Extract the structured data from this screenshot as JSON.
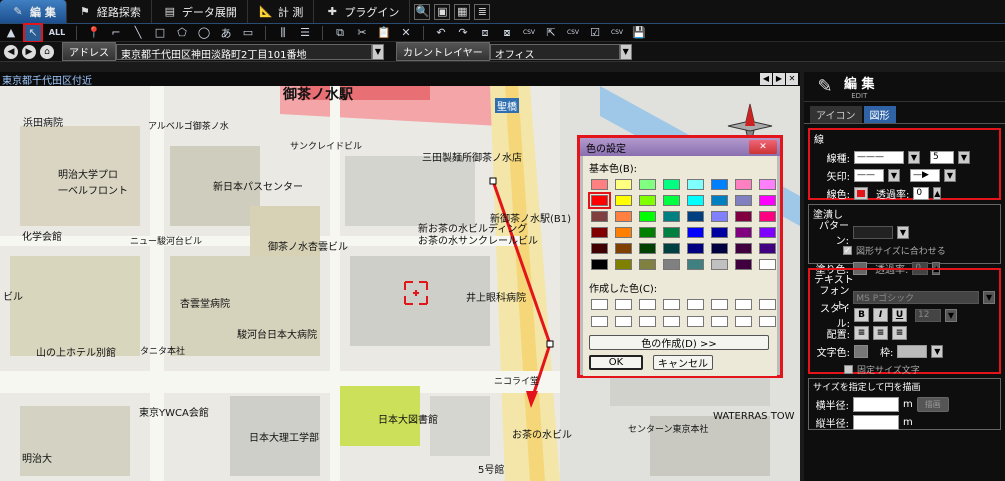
{
  "tabs": [
    {
      "label": "編 集",
      "icon": "edit-icon"
    },
    {
      "label": "経路探索",
      "icon": "route-icon"
    },
    {
      "label": "データ展開",
      "icon": "data-icon"
    },
    {
      "label": "計 測",
      "icon": "measure-icon"
    },
    {
      "label": "プラグイン",
      "icon": "plugin-icon"
    }
  ],
  "toolbar": {
    "all_label": "ALL",
    "csv1": "CSV",
    "csv2": "CSV",
    "csv3": "CSV"
  },
  "address": {
    "label": "アドレス",
    "value": "東京都千代田区神田淡路町2丁目101番地",
    "layer_label": "カレントレイヤー",
    "layer_value": "オフィス"
  },
  "breadcrumb": "東京都千代田区付近",
  "map": {
    "labels": [
      {
        "text": "御茶ノ水駅"
      },
      {
        "text": "聖橋"
      },
      {
        "text": "浜田病院"
      },
      {
        "text": "アルベルゴ御茶ノ水"
      },
      {
        "text": "サンクレイドビル"
      },
      {
        "text": "明治大学プロ"
      },
      {
        "text": "一ベルフロント"
      },
      {
        "text": "三田製麺所御茶ノ水店"
      },
      {
        "text": "新日本パスセンター"
      },
      {
        "text": "新御茶ノ水駅(B1)"
      },
      {
        "text": "新お茶の水ビルディング"
      },
      {
        "text": "お茶の水サンクレールビル"
      },
      {
        "text": "化学会館"
      },
      {
        "text": "ニュー駿河台ビル"
      },
      {
        "text": "御茶ノ水杏雲ビル"
      },
      {
        "text": "ビル"
      },
      {
        "text": "杏雲堂病院"
      },
      {
        "text": "井上眼科病院"
      },
      {
        "text": "駿河台日本大病院"
      },
      {
        "text": "山の上ホテル別館"
      },
      {
        "text": "タニタ本社"
      },
      {
        "text": "ニコライ堂"
      },
      {
        "text": "東京YWCA会館"
      },
      {
        "text": "日本大図書館"
      },
      {
        "text": "日本大理工学部"
      },
      {
        "text": "お茶の水ビル"
      },
      {
        "text": "センターン東京本社"
      },
      {
        "text": "WATERRAS TOW"
      },
      {
        "text": "明治大"
      },
      {
        "text": "5号館"
      }
    ]
  },
  "panel": {
    "title": "編 集",
    "subtitle": "EDIT",
    "tabs": [
      "アイコン",
      "図形"
    ],
    "line_group": {
      "title": "線",
      "line_type_label": "線種:",
      "width_value": "5",
      "arrow_label": "矢印:",
      "color_label": "線色:",
      "color": "#e3141a",
      "transparency_label": "透過率:",
      "transparency_value": "0"
    },
    "fill_group": {
      "title": "塗潰し",
      "pattern_label": "パターン:",
      "fit_label": "図形サイズに合わせる",
      "fill_color_label": "塗り色:",
      "transparency_label": "透過率:",
      "transparency_value": "0"
    },
    "text_group": {
      "title": "テキスト",
      "font_label": "フォント:",
      "font_value": "MS Pゴシック",
      "style_label": "スタイル:",
      "bold": "B",
      "italic": "I",
      "underline": "U",
      "size_value": "12",
      "align_label": "配置:",
      "text_color_label": "文字色:",
      "frame_label": "枠:",
      "fixed_label": "固定サイズ文字"
    },
    "circle_group": {
      "title": "サイズを指定して円を描画",
      "h_radius_label": "横半径:",
      "v_radius_label": "縦半径:",
      "unit": "m",
      "draw_button": "描画"
    }
  },
  "dialog": {
    "title": "色の設定",
    "basic_label": "基本色(B):",
    "custom_label": "作成した色(C):",
    "define_button": "色の作成(D) >>",
    "ok_button": "OK",
    "cancel_button": "キャンセル",
    "basic_colors": [
      "#ff8080",
      "#ffff80",
      "#80ff80",
      "#00ff80",
      "#80ffff",
      "#0080ff",
      "#ff80c0",
      "#ff80ff",
      "#ff0000",
      "#ffff00",
      "#80ff00",
      "#00ff40",
      "#00ffff",
      "#0080c0",
      "#8080c0",
      "#ff00ff",
      "#804040",
      "#ff8040",
      "#00ff00",
      "#008080",
      "#004080",
      "#8080ff",
      "#800040",
      "#ff0080",
      "#800000",
      "#ff8000",
      "#008000",
      "#008040",
      "#0000ff",
      "#0000a0",
      "#800080",
      "#8000ff",
      "#400000",
      "#804000",
      "#004000",
      "#004040",
      "#000080",
      "#000040",
      "#400040",
      "#400080",
      "#000000",
      "#808000",
      "#808040",
      "#808080",
      "#408080",
      "#c0c0c0",
      "#400040",
      "#ffffff"
    ]
  }
}
